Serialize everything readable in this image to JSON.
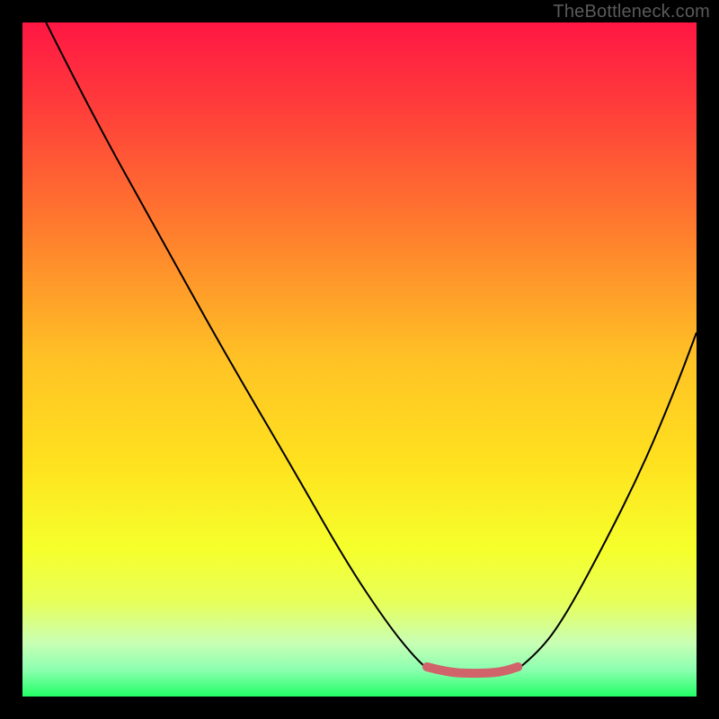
{
  "watermark": "TheBottleneck.com",
  "chart_data": {
    "type": "line",
    "title": "",
    "xlabel": "",
    "ylabel": "",
    "xlim": [
      0,
      100
    ],
    "ylim": [
      100,
      0
    ],
    "gradient_stops": [
      {
        "offset": 0,
        "color": "#ff1744"
      },
      {
        "offset": 12,
        "color": "#ff3b3b"
      },
      {
        "offset": 30,
        "color": "#ff7a2e"
      },
      {
        "offset": 50,
        "color": "#ffc225"
      },
      {
        "offset": 65,
        "color": "#ffe11f"
      },
      {
        "offset": 78,
        "color": "#f6ff2b"
      },
      {
        "offset": 86,
        "color": "#e7ff5a"
      },
      {
        "offset": 92,
        "color": "#c9ffb4"
      },
      {
        "offset": 96,
        "color": "#8cffb0"
      },
      {
        "offset": 100,
        "color": "#22ff66"
      }
    ],
    "series": [
      {
        "name": "curve-left",
        "stroke": "#000000",
        "stroke_width": 2,
        "points": [
          {
            "x": 3.5,
            "y": 0
          },
          {
            "x": 10,
            "y": 13
          },
          {
            "x": 20,
            "y": 31
          },
          {
            "x": 30,
            "y": 49
          },
          {
            "x": 40,
            "y": 66
          },
          {
            "x": 48,
            "y": 80
          },
          {
            "x": 54,
            "y": 89
          },
          {
            "x": 58,
            "y": 94
          },
          {
            "x": 60.5,
            "y": 96.3
          }
        ]
      },
      {
        "name": "curve-right",
        "stroke": "#000000",
        "stroke_width": 2,
        "points": [
          {
            "x": 73,
            "y": 96.3
          },
          {
            "x": 76,
            "y": 94
          },
          {
            "x": 80,
            "y": 89
          },
          {
            "x": 86,
            "y": 78
          },
          {
            "x": 92,
            "y": 66
          },
          {
            "x": 97,
            "y": 54
          },
          {
            "x": 100,
            "y": 46
          }
        ]
      },
      {
        "name": "highlight-band",
        "stroke": "#d1636a",
        "stroke_width": 10,
        "linecap": "round",
        "points": [
          {
            "x": 60,
            "y": 95.6
          },
          {
            "x": 63,
            "y": 96.4
          },
          {
            "x": 67,
            "y": 96.6
          },
          {
            "x": 71,
            "y": 96.4
          },
          {
            "x": 73.5,
            "y": 95.6
          }
        ]
      }
    ]
  }
}
